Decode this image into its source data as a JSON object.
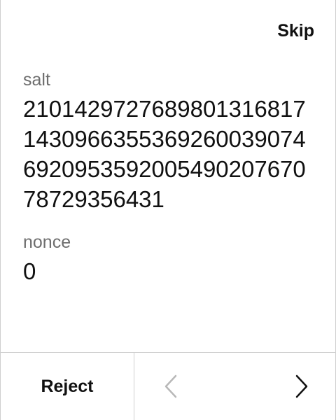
{
  "header": {
    "skip_label": "Skip"
  },
  "fields": {
    "salt": {
      "label": "salt",
      "value": "21014297276898013168171430966355369260039074692095359200549020767078729356431"
    },
    "nonce": {
      "label": "nonce",
      "value": "0"
    }
  },
  "footer": {
    "reject_label": "Reject",
    "prev_icon": "chevron-left-icon",
    "next_icon": "chevron-right-icon"
  },
  "colors": {
    "text": "#111111",
    "label": "#6e6e6e",
    "disabled_icon": "#b8b8b8",
    "divider": "#cfcfcf"
  }
}
